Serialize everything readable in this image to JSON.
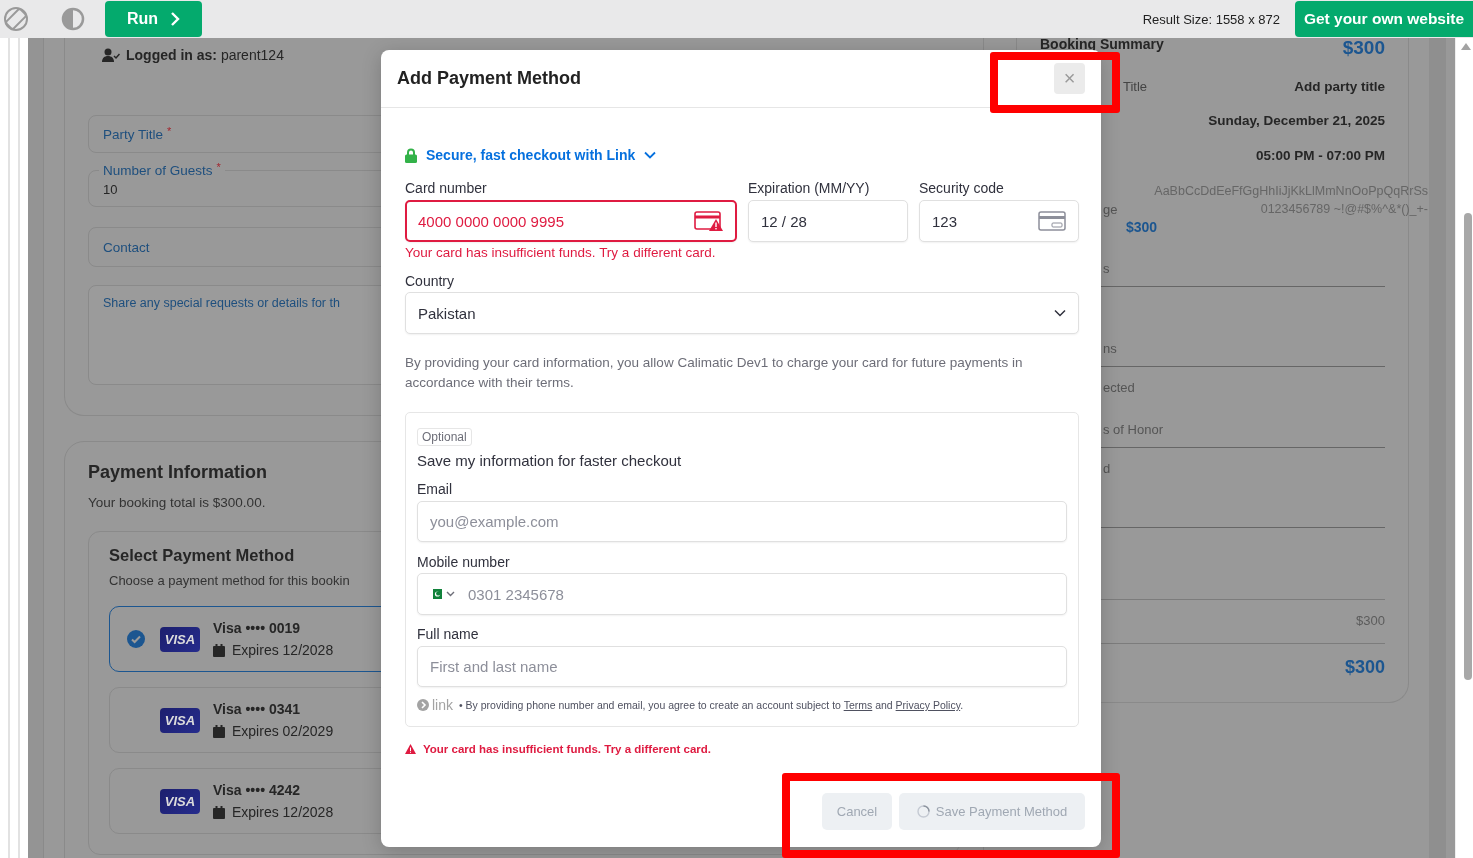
{
  "toolbar": {
    "run_button": "Run",
    "result_size": "Result Size: 1558 x 872",
    "cta_button": "Get your own website"
  },
  "page": {
    "logged_in": "**Logged in as:** parent124",
    "fields": [
      {
        "kind": "outlined",
        "label": "Party Title",
        "required_mark": "*"
      },
      {
        "kind": "notched",
        "label": "Number of Guests",
        "required_mark": "*",
        "value": "10"
      },
      {
        "kind": "outlined",
        "label": "Contact"
      },
      {
        "kind": "textarea",
        "placeholder": "Share any special requests or details for th"
      }
    ],
    "payment": {
      "title": "Payment Information",
      "subtitle": "Your booking total is $300.00.",
      "select_title": "Select Payment Method",
      "select_subtitle": "Choose a payment method for this bookin",
      "cards": [
        {
          "brand": "VISA",
          "name": "Visa •••• 0019",
          "expires": "Expires 12/2028",
          "selected": true
        },
        {
          "brand": "VISA",
          "name": "Visa •••• 0341",
          "expires": "Expires 02/2029",
          "selected": false
        },
        {
          "brand": "VISA",
          "name": "Visa •••• 4242",
          "expires": "Expires 12/2028",
          "selected": false
        }
      ]
    }
  },
  "summary": {
    "title": "Booking Summary",
    "amount": "$300",
    "rows": [
      {
        "kind": "value",
        "label": "Title",
        "value": "Add party title"
      },
      {
        "kind": "value",
        "value": "Sunday, December 21, 2025"
      },
      {
        "kind": "value",
        "value": "05:00 PM - 07:00 PM"
      },
      {
        "kind": "sample",
        "label": "ge",
        "lines": [
          "AaBbCcDdEeFfGgHhIiJjKkLlMmNnOoPpQqRrSs",
          "0123456789 ~!@#$%^&*()_+-"
        ],
        "amount": "$300"
      },
      {
        "kind": "label",
        "label": "s"
      },
      {
        "kind": "label",
        "label": "ns"
      },
      {
        "kind": "label",
        "label": "ected"
      },
      {
        "kind": "label",
        "label": "s of Honor"
      },
      {
        "kind": "label",
        "label": "d"
      },
      {
        "kind": "subtotal",
        "value": "$300"
      },
      {
        "kind": "total",
        "value": "$300"
      }
    ]
  },
  "modal": {
    "title": "Add Payment Method",
    "close": "×",
    "link_banner": "Secure, fast checkout with Link",
    "card_number": {
      "label": "Card number",
      "value": "4000 0000 0000 9995",
      "invalid": true
    },
    "expiry": {
      "label": "Expiration (MM/YY)",
      "value": "12 / 28"
    },
    "cvc": {
      "label": "Security code",
      "value": "123"
    },
    "card_error": "Your card has insufficient funds. Try a different card.",
    "country": {
      "label": "Country",
      "value": "Pakistan"
    },
    "consent": "By providing your card information, you allow Calimatic Dev1 to charge your card for future payments in accordance with their terms.",
    "save_info": {
      "badge": "Optional",
      "title": "Save my information for faster checkout",
      "email": {
        "label": "Email",
        "placeholder": "you@example.com"
      },
      "phone": {
        "label": "Mobile number",
        "placeholder": "0301 2345678"
      },
      "name": {
        "label": "Full name",
        "placeholder": "First and last name"
      },
      "logo": "link",
      "terms": {
        "lead": "• By providing phone number and email, you agree to create an account subject to",
        "link_1": "Terms",
        "joiner": "and",
        "link_2": "Privacy Policy",
        "end": "."
      }
    },
    "error": "Your card has insufficient funds. Try a different card.",
    "buttons": [
      {
        "kind": "cancel",
        "label": "Cancel",
        "disabled": true,
        "busy": false
      },
      {
        "kind": "submit",
        "label": "Save Payment Method",
        "disabled": true,
        "busy": true
      }
    ]
  }
}
